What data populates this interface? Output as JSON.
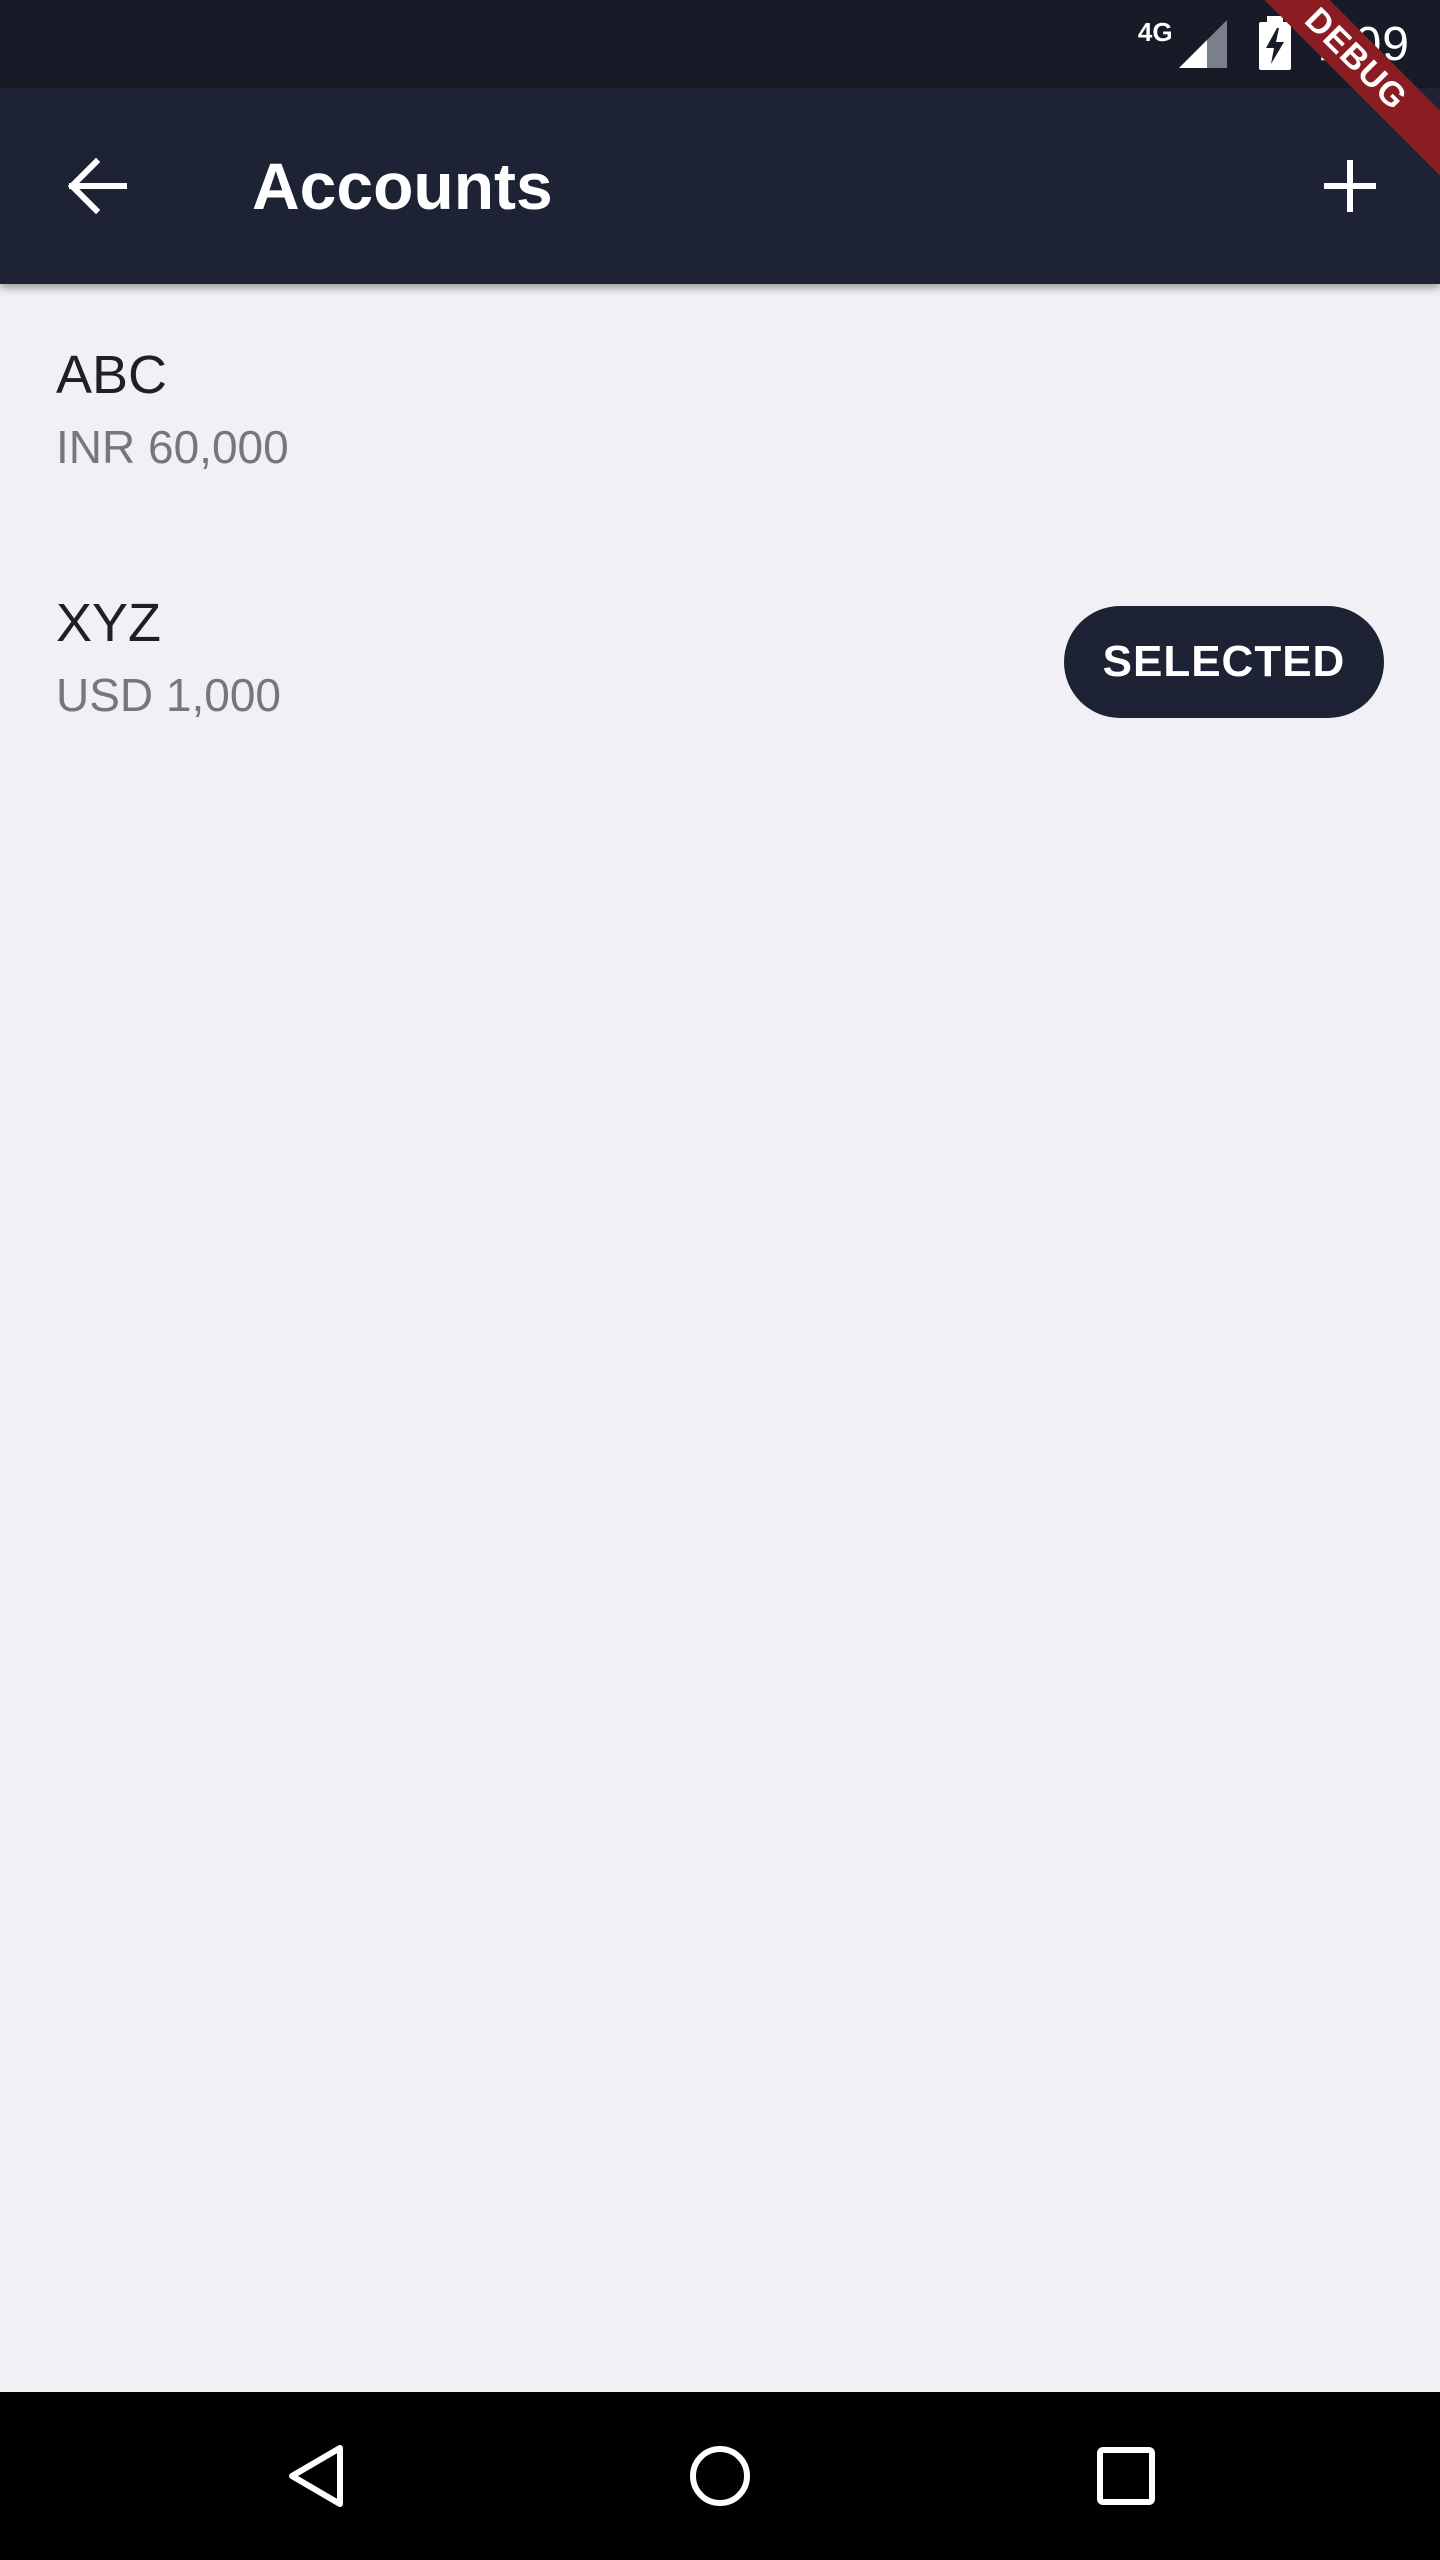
{
  "status_bar": {
    "network": "4G",
    "time": "7:09",
    "icons": [
      "signal-icon",
      "battery-charging-icon"
    ]
  },
  "debug_banner": {
    "label": "DEBUG",
    "color": "#8b1d22"
  },
  "app_bar": {
    "title": "Accounts",
    "back_icon": "arrow-back-icon",
    "add_icon": "plus-icon",
    "color": "#1d2335"
  },
  "accounts": [
    {
      "name": "ABC",
      "balance": "INR 60,000",
      "selected": false
    },
    {
      "name": "XYZ",
      "balance": "USD 1,000",
      "selected": true,
      "badge": "SELECTED"
    }
  ],
  "nav_bar": {
    "icons": [
      "nav-back-icon",
      "nav-home-icon",
      "nav-recents-icon"
    ]
  },
  "colors": {
    "background": "#f0f0f5",
    "status_bar": "#161b27",
    "primary_text": "#1f1f24",
    "secondary_text": "#767680",
    "badge_bg": "#1d2335"
  }
}
